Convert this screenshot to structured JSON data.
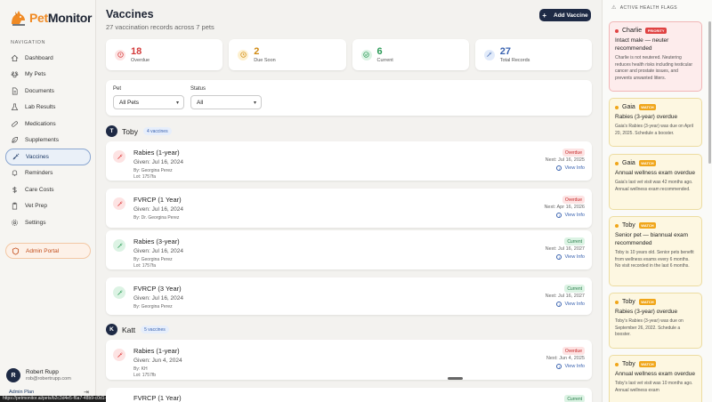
{
  "app": {
    "name_pre": "Pet",
    "name_main": "Monitor"
  },
  "nav": {
    "heading": "Navigation",
    "items": [
      {
        "label": "Dashboard",
        "icon": "home-icon"
      },
      {
        "label": "My Pets",
        "icon": "paw-icon"
      },
      {
        "label": "Documents",
        "icon": "document-icon"
      },
      {
        "label": "Lab Results",
        "icon": "flask-icon"
      },
      {
        "label": "Medications",
        "icon": "pill-icon"
      },
      {
        "label": "Supplements",
        "icon": "leaf-icon"
      },
      {
        "label": "Vaccines",
        "icon": "syringe-icon",
        "active": true
      },
      {
        "label": "Reminders",
        "icon": "bell-icon"
      },
      {
        "label": "Care Costs",
        "icon": "dollar-icon"
      },
      {
        "label": "Vet Prep",
        "icon": "clipboard-icon"
      },
      {
        "label": "Settings",
        "icon": "gear-icon"
      }
    ],
    "admin": "Admin Portal"
  },
  "user": {
    "initial": "R",
    "name": "Robert Rupp",
    "email": "rob@robertrupp.com",
    "plan": "Admin Plan"
  },
  "status_url": "https://petmonitor.ai/pets/b2c3d4e5-f6a7-48b9-c0d1-e2f3a4b5c6d7",
  "header": {
    "title": "Vaccines",
    "subtitle": "27 vaccination records across 7 pets",
    "add_label": "Add Vaccine"
  },
  "stats": [
    {
      "value": "18",
      "label": "Overdue",
      "color": "#d33a3a",
      "bg": "#fde3e3",
      "icon": "alert-icon"
    },
    {
      "value": "2",
      "label": "Due Soon",
      "color": "#d08a12",
      "bg": "#fdf0cf",
      "icon": "clock-icon"
    },
    {
      "value": "6",
      "label": "Current",
      "color": "#2a9a56",
      "bg": "#dcf3e4",
      "icon": "check-icon"
    },
    {
      "value": "27",
      "label": "Total Records",
      "color": "#3a63b0",
      "bg": "#e2ebfa",
      "icon": "syringe-icon"
    }
  ],
  "filters": {
    "pet_label": "Pet",
    "pet_value": "All Pets",
    "status_label": "Status",
    "status_value": "All"
  },
  "groups": [
    {
      "initial": "T",
      "name": "Toby",
      "count": "4 vaccines"
    },
    {
      "initial": "K",
      "name": "Katt",
      "count": "5 vaccines"
    }
  ],
  "vaccines": [
    {
      "name": "Rabies (1-year)",
      "given": "Given: Jul 16, 2024",
      "by": "By: Georgina Perez",
      "lot": "Lot: 1757fa",
      "status": "Overdue",
      "next": "Next: Jul 16, 2025",
      "view": "View Info"
    },
    {
      "name": "FVRCP (1 Year)",
      "given": "Given: Jul 16, 2024",
      "by": "By: Dr. Georgina Perez",
      "lot": "",
      "status": "Overdue",
      "next": "Next: Apr 16, 2026",
      "view": "View Info"
    },
    {
      "name": "Rabies (3-year)",
      "given": "Given: Jul 16, 2024",
      "by": "By: Georgina Perez",
      "lot": "Lot: 1757fa",
      "status": "Current",
      "next": "Next: Jul 16, 2027",
      "view": "View Info"
    },
    {
      "name": "FVRCP (3 Year)",
      "given": "Given: Jul 16, 2024",
      "by": "By: Georgina Perez",
      "lot": "",
      "status": "Current",
      "next": "Next: Jul 16, 2027",
      "view": "View Info"
    },
    {
      "name": "Rabies (1-year)",
      "given": "Given: Jun 4, 2024",
      "by": "By: KH",
      "lot": "Lot: 1757fb",
      "status": "Overdue",
      "next": "Next: Jun 4, 2025",
      "view": "View Info"
    },
    {
      "name": "FVRCP (1 Year)",
      "given": "",
      "by": "",
      "lot": "",
      "status": "Current",
      "next": "",
      "view": ""
    }
  ],
  "flags_heading": "Active Health Flags",
  "flags": [
    {
      "pet": "Charlie",
      "tag": "PRIORITY",
      "kind": "priority",
      "title": "Intact male — neuter recommended",
      "body": "Charlie is not neutered. Neutering reduces health risks including testicular cancer and prostate issues, and prevents unwanted litters."
    },
    {
      "pet": "Gaia",
      "tag": "WATCH",
      "kind": "watch",
      "title": "Rabies (3-year) overdue",
      "body": "Gaia's Rabies (3-year) was due on April 20, 2025. Schedule a booster."
    },
    {
      "pet": "Gaia",
      "tag": "WATCH",
      "kind": "watch",
      "title": "Annual wellness exam overdue",
      "body": "Gaia's last vet visit was 42 months ago. Annual wellness exam recommended."
    },
    {
      "pet": "Toby",
      "tag": "WATCH",
      "kind": "watch",
      "title": "Senior pet — biannual exam recommended",
      "body": "Toby is 10 years old. Senior pets benefit from wellness exams every 6 months. No visit recorded in the last 6 months."
    },
    {
      "pet": "Toby",
      "tag": "WATCH",
      "kind": "watch",
      "title": "Rabies (3-year) overdue",
      "body": "Toby's Rabies (3-year) was due on September 26, 2022. Schedule a booster."
    },
    {
      "pet": "Toby",
      "tag": "WATCH",
      "kind": "watch",
      "title": "Annual wellness exam overdue",
      "body": "Toby's last vet visit was 10 months ago. Annual wellness exam"
    }
  ]
}
